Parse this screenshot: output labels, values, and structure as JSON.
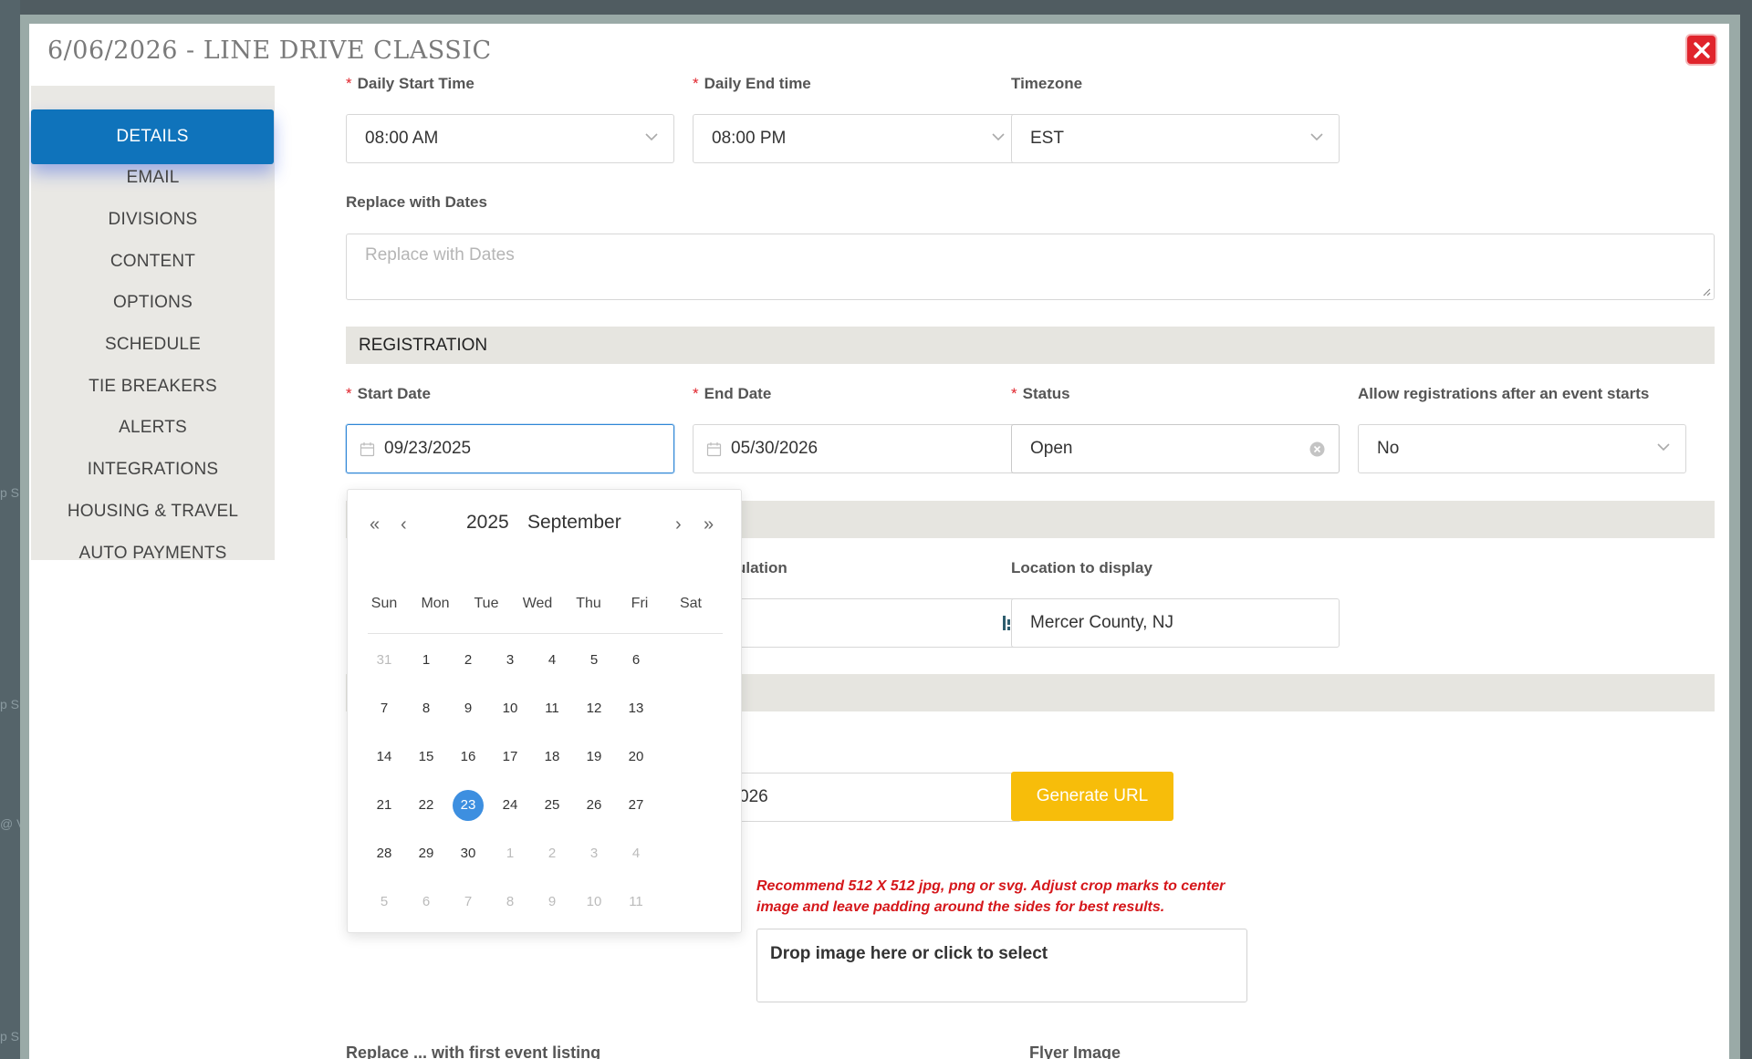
{
  "background": {
    "fragments": [
      "p S",
      "p S",
      "@ V",
      "p S"
    ]
  },
  "modal": {
    "title": "6/06/2026 - LINE DRIVE CLASSIC",
    "close_icon": "close-x-icon"
  },
  "sidebar": {
    "items": [
      {
        "label": "DETAILS",
        "active": true
      },
      {
        "label": "EMAIL"
      },
      {
        "label": "DIVISIONS"
      },
      {
        "label": "CONTENT"
      },
      {
        "label": "OPTIONS"
      },
      {
        "label": "SCHEDULE"
      },
      {
        "label": "TIE BREAKERS"
      },
      {
        "label": "ALERTS"
      },
      {
        "label": "INTEGRATIONS"
      },
      {
        "label": "HOUSING & TRAVEL"
      },
      {
        "label": "AUTO PAYMENTS"
      }
    ]
  },
  "times": {
    "start_label": "Daily Start Time",
    "start_value": "08:00 AM",
    "end_label": "Daily End time",
    "end_value": "08:00 PM",
    "tz_label": "Timezone",
    "tz_value": "EST"
  },
  "replace": {
    "label": "Replace with Dates",
    "placeholder": "Replace with Dates"
  },
  "registration": {
    "section_title": "REGISTRATION",
    "start_label": "Start Date",
    "start_value": "09/23/2025",
    "end_label": "End Date",
    "end_value": "05/30/2026",
    "status_label": "Status",
    "status_value": "Open",
    "allow_label": "Allow registrations after an event starts",
    "allow_value": "No"
  },
  "location": {
    "partial_label": "ulation",
    "display_label": "Location to display",
    "display_value": "Mercer County, NJ"
  },
  "url": {
    "partial_value": "026",
    "generate_label": "Generate URL"
  },
  "image": {
    "recommendation": "Recommend 512 X 512 jpg, png or svg. Adjust crop marks to center image and leave padding around the sides for best results.",
    "dropzone_text": "Drop image here or click to select"
  },
  "footer_cut": {
    "left": "Replace ... with first event listing",
    "right": "Flyer Image"
  },
  "calendar": {
    "year": "2025",
    "month": "September",
    "nav": {
      "prev_year": "«",
      "prev_month": "‹",
      "next_month": "›",
      "next_year": "»"
    },
    "weekdays": [
      "Sun",
      "Mon",
      "Tue",
      "Wed",
      "Thu",
      "Fri",
      "Sat"
    ],
    "weeks": [
      [
        "31",
        "1",
        "2",
        "3",
        "4",
        "5",
        "6"
      ],
      [
        "7",
        "8",
        "9",
        "10",
        "11",
        "12",
        "13"
      ],
      [
        "14",
        "15",
        "16",
        "17",
        "18",
        "19",
        "20"
      ],
      [
        "21",
        "22",
        "23",
        "24",
        "25",
        "26",
        "27"
      ],
      [
        "28",
        "29",
        "30",
        "1",
        "2",
        "3",
        "4"
      ],
      [
        "5",
        "6",
        "7",
        "8",
        "9",
        "10",
        "11"
      ]
    ],
    "selected": "23"
  },
  "colors": {
    "accent": "#0f73bb",
    "danger": "#e0242c",
    "warning_button": "#f7bd0a",
    "selected_day": "#3d8fe0"
  }
}
